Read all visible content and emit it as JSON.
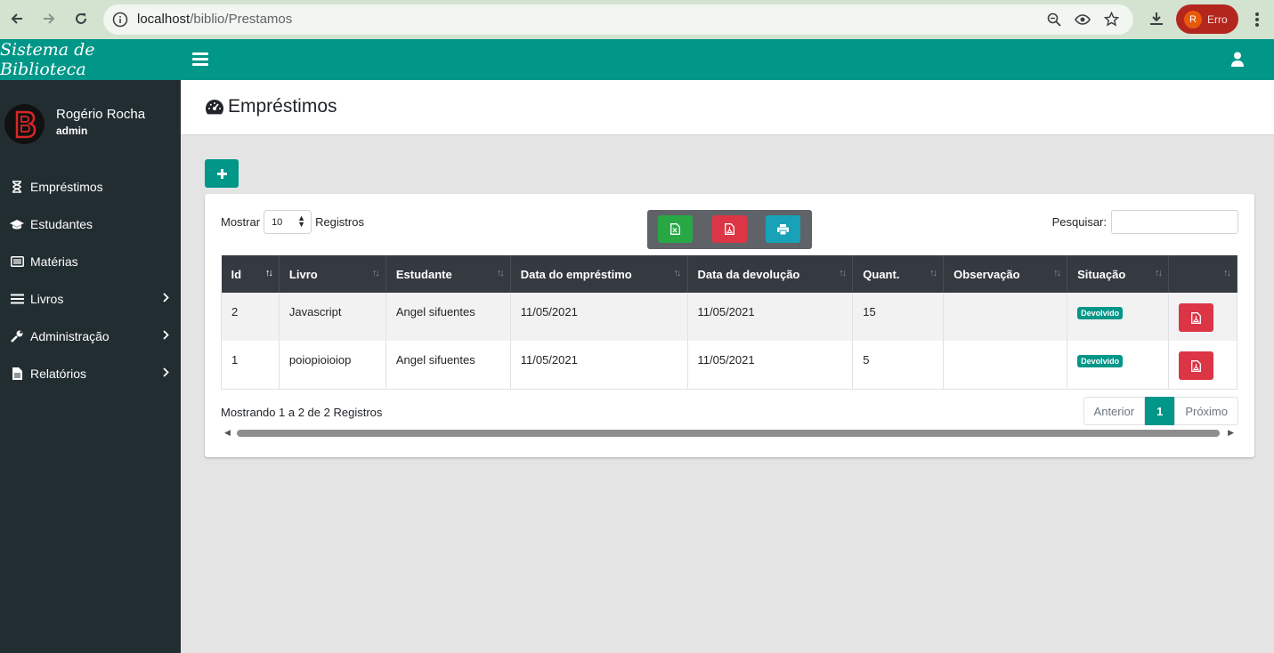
{
  "browser": {
    "url_host": "localhost",
    "url_path": "/biblio/Prestamos",
    "profile_initial": "R",
    "profile_label": "Erro"
  },
  "app": {
    "brand": "Sistema de Biblioteca",
    "primary_color": "#009688",
    "sidebar_color": "#222d32"
  },
  "user": {
    "name": "Rogério Rocha",
    "role": "admin"
  },
  "sidebar": {
    "items": [
      {
        "label": "Empréstimos",
        "icon": "hourglass-icon",
        "submenu": false
      },
      {
        "label": "Estudantes",
        "icon": "graduation-cap-icon",
        "submenu": false
      },
      {
        "label": "Matérias",
        "icon": "list-alt-icon",
        "submenu": false
      },
      {
        "label": "Livros",
        "icon": "list-icon",
        "submenu": true
      },
      {
        "label": "Administração",
        "icon": "wrench-icon",
        "submenu": true
      },
      {
        "label": "Relatórios",
        "icon": "file-text-icon",
        "submenu": true
      }
    ]
  },
  "page": {
    "title": "Empréstimos"
  },
  "table_controls": {
    "show_label": "Mostrar",
    "page_size": "10",
    "records_label": "Registros",
    "search_label": "Pesquisar:",
    "search_value": ""
  },
  "table": {
    "columns": [
      "Id",
      "Livro",
      "Estudante",
      "Data do empréstimo",
      "Data da devolução",
      "Quant.",
      "Observação",
      "Situação",
      ""
    ],
    "rows": [
      {
        "id": "2",
        "livro": "Javascript",
        "estudante": "Angel sifuentes",
        "data_emprestimo": "11/05/2021",
        "data_devolucao": "11/05/2021",
        "quant": "15",
        "observacao": "",
        "situacao": "Devolvido"
      },
      {
        "id": "1",
        "livro": "poiopioioiop",
        "estudante": "Angel sifuentes",
        "data_emprestimo": "11/05/2021",
        "data_devolucao": "11/05/2021",
        "quant": "5",
        "observacao": "",
        "situacao": "Devolvido"
      }
    ]
  },
  "footer": {
    "info": "Mostrando 1 a 2 de 2 Registros",
    "prev": "Anterior",
    "current_page": "1",
    "next": "Próximo"
  }
}
